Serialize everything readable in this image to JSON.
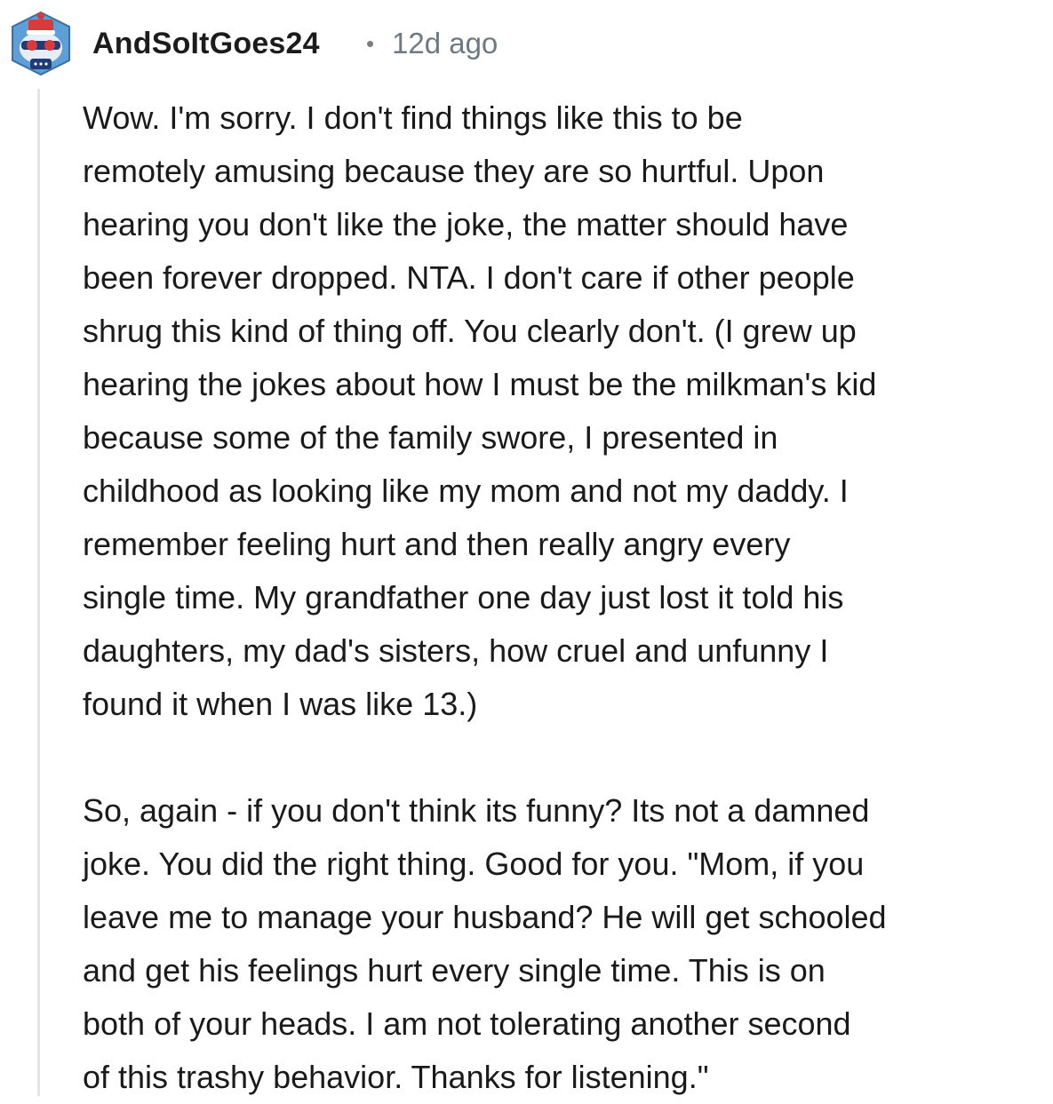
{
  "comment": {
    "author": "AndSoItGoes24",
    "separator": "•",
    "timestamp": "12d ago",
    "paragraph1": [
      "Wow. I'm sorry. I don't find things like this to be",
      "remotely amusing because they are so hurtful. Upon",
      "hearing you don't like the joke, the matter should have",
      "been forever dropped. NTA. I don't care if other people",
      "shrug this kind of thing off. You clearly don't. (I grew up",
      "hearing the jokes about how I must be the milkman's kid",
      "because some of the family swore, I presented in",
      "childhood as looking like my mom and not my daddy. I",
      "remember feeling hurt and then really angry every",
      "single time. My grandfather one day just lost it told his",
      "daughters, my dad's sisters, how cruel and unfunny I",
      "found it when I was like 13.)"
    ],
    "paragraph2": [
      "So, again - if you don't think its funny? Its not a damned",
      "joke. You did the right thing. Good for you. \"Mom, if you",
      "leave me to manage your husband? He will get schooled",
      "and get his feelings hurt every single time. This is on",
      "both of your heads. I am not tolerating another second",
      "of this trashy behavior. Thanks for listening.\""
    ]
  },
  "icons": {
    "avatar": "snoo-avatar-icon"
  },
  "colors": {
    "username": "#1c1c1c",
    "timestamp": "#6c7a86",
    "body_text": "#1a1a1b",
    "thread_line": "#e4e4e4"
  }
}
